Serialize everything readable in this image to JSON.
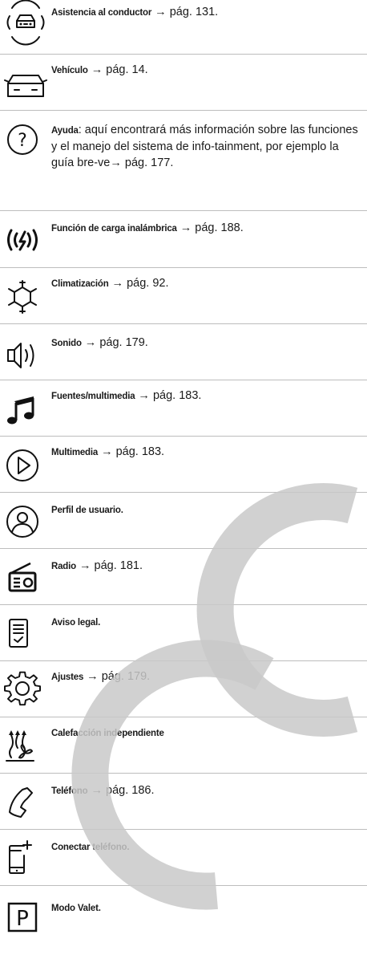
{
  "items": [
    {
      "label": "Asistencia al conductor",
      "text": " → pág. 131.",
      "icon": "driver-assist-icon"
    },
    {
      "label": "Vehículo",
      "text": " → pág. 14.",
      "icon": "vehicle-icon"
    },
    {
      "label": "Ayuda",
      "text": ": aquí encontrará más información sobre las funciones y el manejo del sistema de info-tainment, por ejemplo la guía bre-ve→ pág. 177.",
      "icon": "help-icon"
    },
    {
      "label": "Función de carga inalámbrica",
      "text": " → pág. 188.",
      "icon": "wireless-charging-icon"
    },
    {
      "label": "Climatización",
      "text": " → pág. 92.",
      "icon": "climate-icon"
    },
    {
      "label": "Sonido",
      "text": " → pág. 179.",
      "icon": "sound-icon"
    },
    {
      "label": "Fuentes/multimedia",
      "text": " → pág. 183.",
      "icon": "music-note-icon"
    },
    {
      "label": "Multimedia",
      "text": " → pág. 183.",
      "icon": "play-icon"
    },
    {
      "label": "Perfil de usuario.",
      "text": "",
      "icon": "user-profile-icon"
    },
    {
      "label": "Radio",
      "text": " → pág. 181.",
      "icon": "radio-icon"
    },
    {
      "label": "Aviso legal.",
      "text": "",
      "icon": "legal-notice-icon"
    },
    {
      "label": "Ajustes",
      "text": " → pág. 179.",
      "icon": "settings-gear-icon"
    },
    {
      "label": "Calefacción independiente",
      "text": "",
      "icon": "auxiliary-heating-icon"
    },
    {
      "label": "Teléfono",
      "text": " → pág. 186.",
      "icon": "phone-icon"
    },
    {
      "label": "Conectar teléfono.",
      "text": "",
      "icon": "connect-phone-icon"
    },
    {
      "label": "Modo Valet.",
      "text": "",
      "icon": "valet-parking-icon"
    }
  ]
}
